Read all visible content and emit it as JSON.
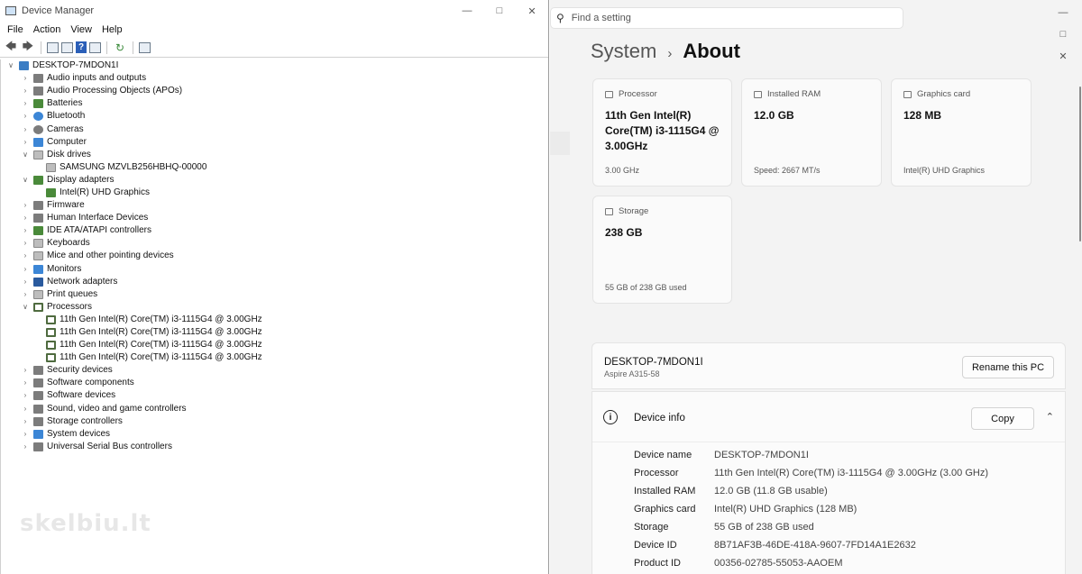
{
  "device_manager": {
    "title": "Device Manager",
    "menu": [
      "File",
      "Action",
      "View",
      "Help"
    ],
    "root": "DESKTOP-7MDON1I",
    "tree": [
      {
        "label": "Audio inputs and outputs",
        "icon": "speaker-icon",
        "expanded": false
      },
      {
        "label": "Audio Processing Objects (APOs)",
        "icon": "speaker-icon",
        "expanded": false
      },
      {
        "label": "Batteries",
        "icon": "battery-icon",
        "expanded": false
      },
      {
        "label": "Bluetooth",
        "icon": "bluetooth-icon",
        "expanded": false
      },
      {
        "label": "Cameras",
        "icon": "camera-icon",
        "expanded": false
      },
      {
        "label": "Computer",
        "icon": "monitor-icon",
        "expanded": false
      },
      {
        "label": "Disk drives",
        "icon": "disk-icon",
        "expanded": true,
        "children": [
          "SAMSUNG MZVLB256HBHQ-00000"
        ]
      },
      {
        "label": "Display adapters",
        "icon": "display-adapter-icon",
        "expanded": true,
        "children": [
          "Intel(R) UHD Graphics"
        ]
      },
      {
        "label": "Firmware",
        "icon": "firmware-icon",
        "expanded": false
      },
      {
        "label": "Human Interface Devices",
        "icon": "hid-icon",
        "expanded": false
      },
      {
        "label": "IDE ATA/ATAPI controllers",
        "icon": "controller-icon",
        "expanded": false
      },
      {
        "label": "Keyboards",
        "icon": "keyboard-icon",
        "expanded": false
      },
      {
        "label": "Mice and other pointing devices",
        "icon": "mouse-icon",
        "expanded": false
      },
      {
        "label": "Monitors",
        "icon": "monitor-icon",
        "expanded": false
      },
      {
        "label": "Network adapters",
        "icon": "network-icon",
        "expanded": false
      },
      {
        "label": "Print queues",
        "icon": "printer-icon",
        "expanded": false
      },
      {
        "label": "Processors",
        "icon": "processor-icon",
        "expanded": true,
        "children": [
          "11th Gen Intel(R) Core(TM) i3-1115G4 @ 3.00GHz",
          "11th Gen Intel(R) Core(TM) i3-1115G4 @ 3.00GHz",
          "11th Gen Intel(R) Core(TM) i3-1115G4 @ 3.00GHz",
          "11th Gen Intel(R) Core(TM) i3-1115G4 @ 3.00GHz"
        ]
      },
      {
        "label": "Security devices",
        "icon": "security-icon",
        "expanded": false
      },
      {
        "label": "Software components",
        "icon": "component-icon",
        "expanded": false
      },
      {
        "label": "Software devices",
        "icon": "component-icon",
        "expanded": false
      },
      {
        "label": "Sound, video and game controllers",
        "icon": "speaker-icon",
        "expanded": false
      },
      {
        "label": "Storage controllers",
        "icon": "storage-icon",
        "expanded": false
      },
      {
        "label": "System devices",
        "icon": "system-icon",
        "expanded": false
      },
      {
        "label": "Universal Serial Bus controllers",
        "icon": "usb-icon",
        "expanded": false
      }
    ],
    "watermark": "skelbiu.lt"
  },
  "settings": {
    "search_placeholder": "Find a setting",
    "breadcrumb_parent": "System",
    "breadcrumb_separator": "›",
    "breadcrumb_current": "About",
    "specs_cards": {
      "processor": {
        "label": "Processor",
        "value": "11th Gen Intel(R) Core(TM) i3-1115G4 @ 3.00GHz",
        "sub": "3.00 GHz"
      },
      "ram": {
        "label": "Installed RAM",
        "value": "12.0 GB",
        "sub": "Speed: 2667 MT/s"
      },
      "graphics": {
        "label": "Graphics card",
        "value": "128 MB",
        "sub": "Intel(R) UHD Graphics"
      },
      "storage": {
        "label": "Storage",
        "value": "238 GB",
        "sub": "55 GB of 238 GB used"
      }
    },
    "pc_name": "DESKTOP-7MDON1I",
    "pc_model": "Aspire A315-58",
    "rename_label": "Rename this PC",
    "device_info_title": "Device info",
    "copy_label": "Copy",
    "device_info": [
      {
        "key": "Device name",
        "value": "DESKTOP-7MDON1I"
      },
      {
        "key": "Processor",
        "value": "11th Gen Intel(R) Core(TM) i3-1115G4 @ 3.00GHz (3.00 GHz)"
      },
      {
        "key": "Installed RAM",
        "value": "12.0 GB (11.8 GB usable)"
      },
      {
        "key": "Graphics card",
        "value": "Intel(R) UHD Graphics (128 MB)"
      },
      {
        "key": "Storage",
        "value": "55 GB of 238 GB used"
      },
      {
        "key": "Device ID",
        "value": "8B71AF3B-46DE-418A-9607-7FD14A1E2632"
      },
      {
        "key": "Product ID",
        "value": "00356-02785-55053-AAOEM"
      }
    ]
  }
}
